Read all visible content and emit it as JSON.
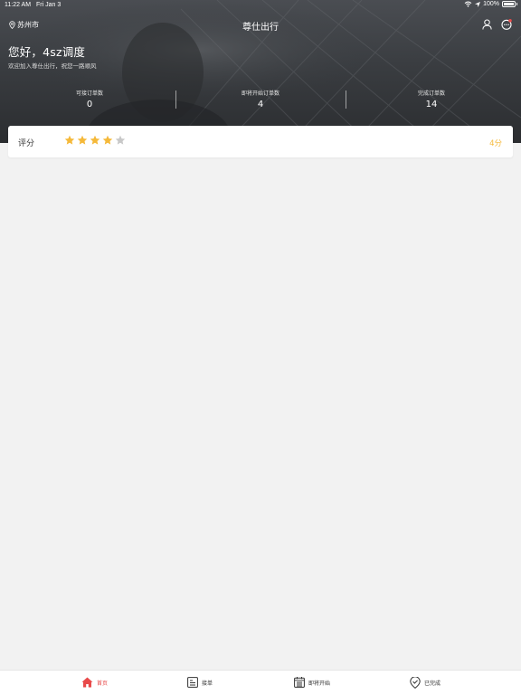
{
  "status_bar": {
    "time": "11:22 AM",
    "date": "Fri Jan 3",
    "battery": "100%"
  },
  "nav": {
    "location": "苏州市",
    "title": "尊仕出行"
  },
  "greeting": {
    "title": "您好，4sz调度",
    "subtitle": "欢迎加入尊仕出行，祝您一路顺风"
  },
  "stats": [
    {
      "label": "可接订单数",
      "value": "0"
    },
    {
      "label": "即将开始订单数",
      "value": "4"
    },
    {
      "label": "完成订单数",
      "value": "14"
    }
  ],
  "rating": {
    "label": "评分",
    "stars_filled": 4,
    "stars_total": 5,
    "score": "4分",
    "star_color": "#f5b93a",
    "star_empty_color": "#c8c8c8"
  },
  "tabs": [
    {
      "label": "首页",
      "icon": "home-icon",
      "active": true
    },
    {
      "label": "接单",
      "icon": "order-list-icon",
      "active": false
    },
    {
      "label": "即将开始",
      "icon": "calendar-list-icon",
      "active": false
    },
    {
      "label": "已完成",
      "icon": "check-shield-icon",
      "active": false
    }
  ],
  "colors": {
    "accent": "#e84a4a",
    "score": "#f5b93a"
  }
}
